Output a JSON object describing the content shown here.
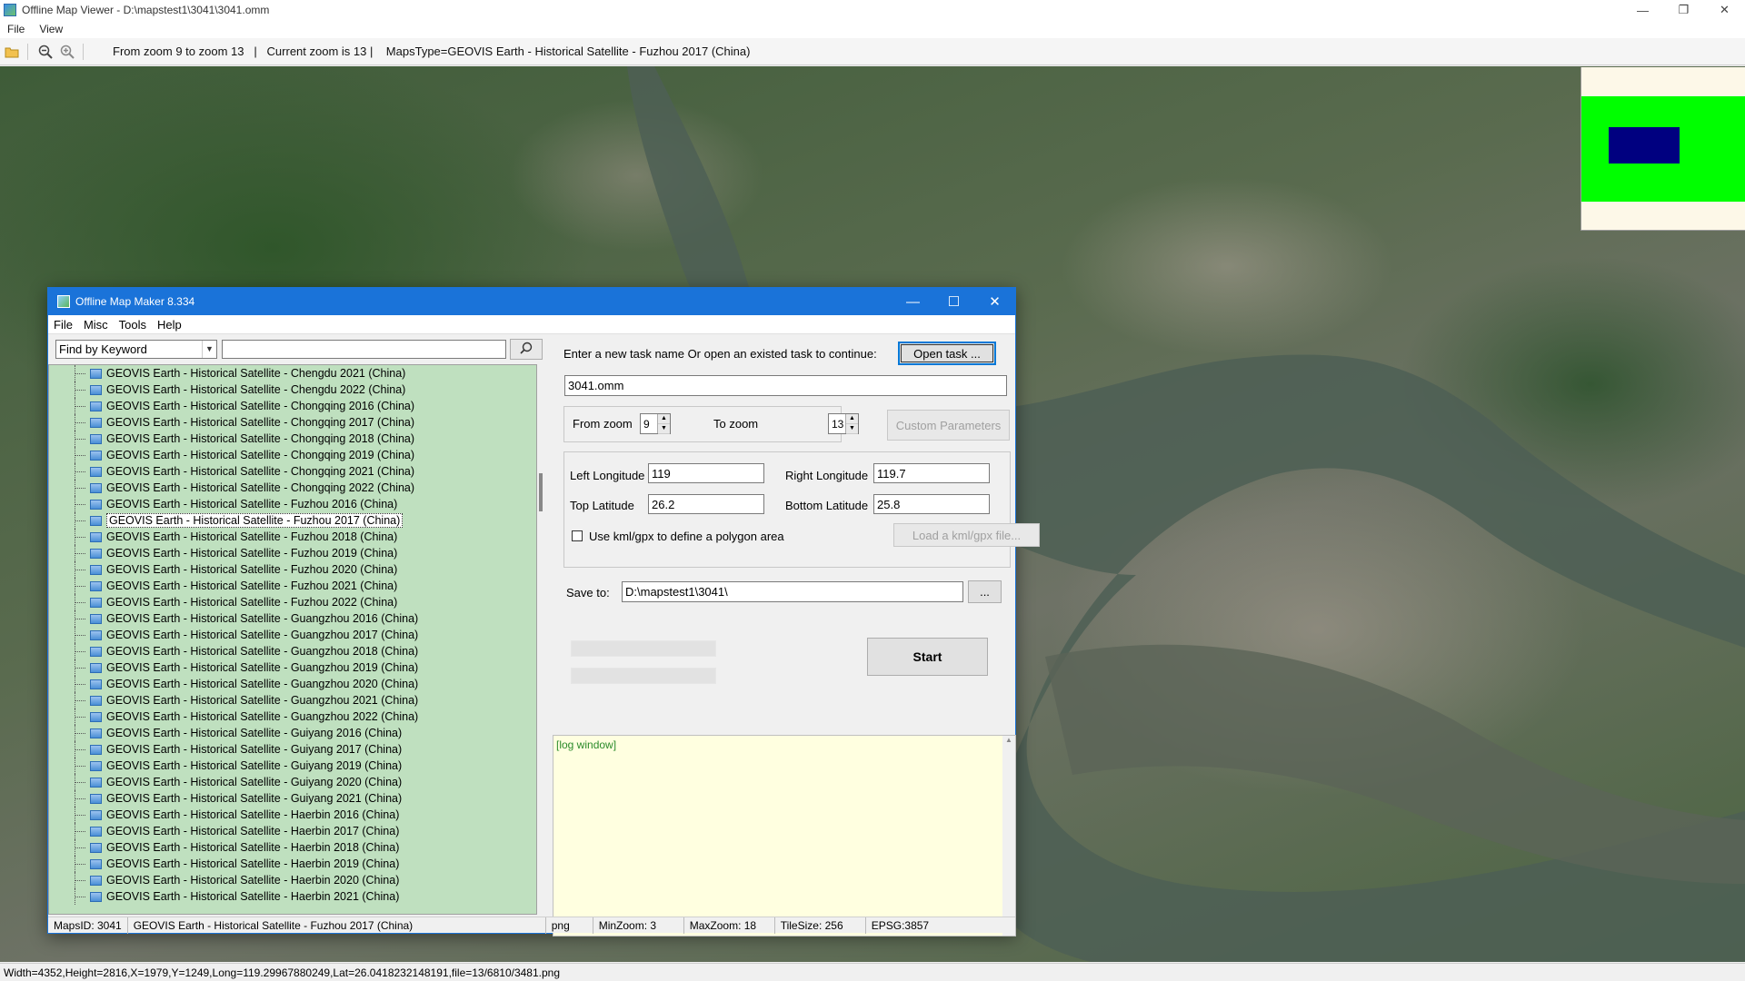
{
  "window": {
    "title": "Offline Map Viewer - D:\\mapstest1\\3041\\3041.omm",
    "controls": {
      "minimize": "—",
      "restore": "❐",
      "close": "✕"
    }
  },
  "menu": {
    "file": "File",
    "view": "View"
  },
  "toolbar": {
    "open_icon": "folder-open-icon",
    "zoom_out_icon": "zoom-out-icon",
    "zoom_in_icon": "zoom-in-icon",
    "info": "From zoom 9 to zoom 13   |   Current zoom is 13 |    MapsType=GEOVIS Earth - Historical Satellite - Fuzhou 2017 (China)"
  },
  "status_bar": {
    "text": "Width=4352,Height=2816,X=1979,Y=1249,Long=119.29967880249,Lat=26.0418232148191,file=13/6810/3481.png"
  },
  "overview": {
    "background": "#fdf8e8",
    "band_color": "#00ff00",
    "viewport_color": "#000080"
  },
  "dialog": {
    "title": "Offline Map Maker 8.334",
    "controls": {
      "minimize": "—",
      "maximize": "☐",
      "close": "✕"
    },
    "menu": [
      "File",
      "Misc",
      "Tools",
      "Help"
    ],
    "search": {
      "mode": "Find by Keyword",
      "keyword": "",
      "button_icon": "search-icon"
    },
    "tree_items": [
      "GEOVIS Earth - Historical Satellite - Chengdu 2021 (China)",
      "GEOVIS Earth - Historical Satellite - Chengdu 2022 (China)",
      "GEOVIS Earth - Historical Satellite - Chongqing 2016 (China)",
      "GEOVIS Earth - Historical Satellite - Chongqing 2017 (China)",
      "GEOVIS Earth - Historical Satellite - Chongqing 2018 (China)",
      "GEOVIS Earth - Historical Satellite - Chongqing 2019 (China)",
      "GEOVIS Earth - Historical Satellite - Chongqing 2021 (China)",
      "GEOVIS Earth - Historical Satellite - Chongqing 2022 (China)",
      "GEOVIS Earth - Historical Satellite - Fuzhou 2016 (China)",
      "GEOVIS Earth - Historical Satellite - Fuzhou 2017 (China)",
      "GEOVIS Earth - Historical Satellite - Fuzhou 2018 (China)",
      "GEOVIS Earth - Historical Satellite - Fuzhou 2019 (China)",
      "GEOVIS Earth - Historical Satellite - Fuzhou 2020 (China)",
      "GEOVIS Earth - Historical Satellite - Fuzhou 2021 (China)",
      "GEOVIS Earth - Historical Satellite - Fuzhou 2022 (China)",
      "GEOVIS Earth - Historical Satellite - Guangzhou 2016 (China)",
      "GEOVIS Earth - Historical Satellite - Guangzhou 2017 (China)",
      "GEOVIS Earth - Historical Satellite - Guangzhou 2018 (China)",
      "GEOVIS Earth - Historical Satellite - Guangzhou 2019 (China)",
      "GEOVIS Earth - Historical Satellite - Guangzhou 2020 (China)",
      "GEOVIS Earth - Historical Satellite - Guangzhou 2021 (China)",
      "GEOVIS Earth - Historical Satellite - Guangzhou 2022 (China)",
      "GEOVIS Earth - Historical Satellite - Guiyang 2016 (China)",
      "GEOVIS Earth - Historical Satellite - Guiyang 2017 (China)",
      "GEOVIS Earth - Historical Satellite - Guiyang 2019 (China)",
      "GEOVIS Earth - Historical Satellite - Guiyang 2020 (China)",
      "GEOVIS Earth - Historical Satellite - Guiyang 2021 (China)",
      "GEOVIS Earth - Historical Satellite - Haerbin 2016 (China)",
      "GEOVIS Earth - Historical Satellite - Haerbin 2017 (China)",
      "GEOVIS Earth - Historical Satellite - Haerbin 2018 (China)",
      "GEOVIS Earth - Historical Satellite - Haerbin 2019 (China)",
      "GEOVIS Earth - Historical Satellite - Haerbin 2020 (China)",
      "GEOVIS Earth - Historical Satellite - Haerbin 2021 (China)"
    ],
    "selected_item": "GEOVIS Earth - Historical Satellite - Fuzhou 2017 (China)",
    "task_prompt": "Enter a new task name Or open an existed task to continue:",
    "open_task_label": "Open task ...",
    "task_name": "3041.omm",
    "from_zoom_label": "From zoom",
    "from_zoom": "9",
    "to_zoom_label": "To zoom",
    "to_zoom": "13",
    "custom_params_label": "Custom Parameters",
    "left_lon_label": "Left Longitude",
    "left_lon": "119",
    "right_lon_label": "Right Longitude",
    "right_lon": "119.7",
    "top_lat_label": "Top Latitude",
    "top_lat": "26.2",
    "bottom_lat_label": "Bottom Latitude",
    "bottom_lat": "25.8",
    "kml_checkbox_label": "Use kml/gpx to define a polygon area",
    "kml_checked": false,
    "load_kml_label": "Load a kml/gpx file...",
    "save_to_label": "Save to:",
    "save_to": "D:\\mapstest1\\3041\\",
    "browse_label": "...",
    "start_label": "Start",
    "log_text": "[log window]",
    "status": {
      "maps_id": "MapsID: 3041",
      "maps_name": "GEOVIS Earth - Historical Satellite - Fuzhou 2017 (China)",
      "format": "png",
      "min_zoom": "MinZoom: 3",
      "max_zoom": "MaxZoom: 18",
      "tile_size": "TileSize: 256",
      "epsg": "EPSG:3857"
    }
  }
}
